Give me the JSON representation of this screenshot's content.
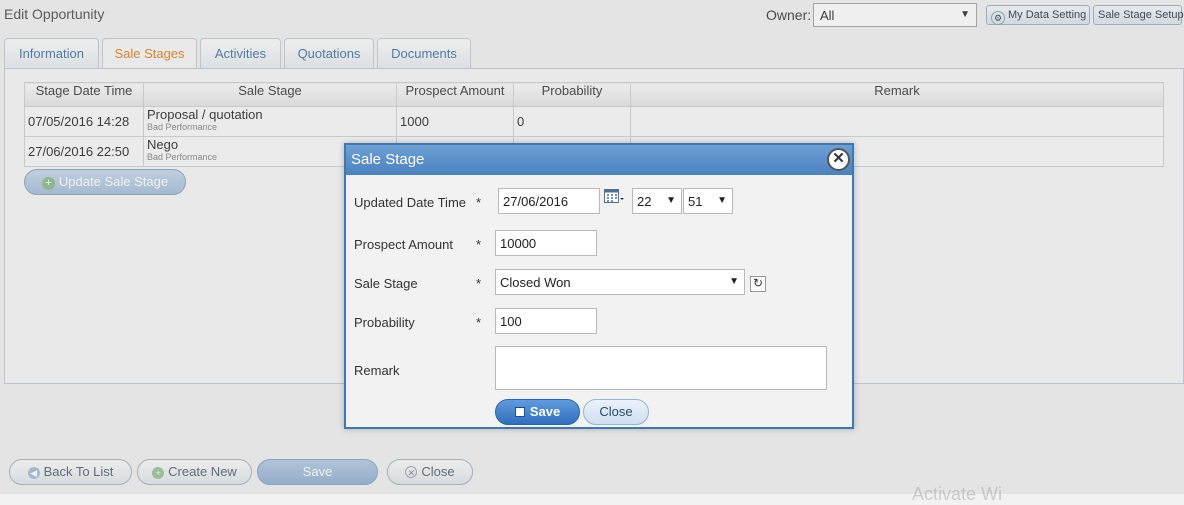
{
  "page": {
    "title": "Edit Opportunity",
    "owner_label": "Owner:",
    "owner_value": "All",
    "my_data_setting": "My Data Setting",
    "sale_stage_setup": "Sale Stage Setup"
  },
  "tabs": [
    {
      "label": "Information"
    },
    {
      "label": "Sale Stages"
    },
    {
      "label": "Activities"
    },
    {
      "label": "Quotations"
    },
    {
      "label": "Documents"
    }
  ],
  "grid": {
    "headers": [
      "Stage Date Time",
      "Sale Stage",
      "Prospect Amount",
      "Probability",
      "Remark"
    ],
    "rows": [
      {
        "date": "07/05/2016 14:28",
        "stage": "Proposal / quotation",
        "sub": "Bad Performance",
        "amount": "1000",
        "probability": "0",
        "remark": ""
      },
      {
        "date": "27/06/2016 22:50",
        "stage": "Nego",
        "sub": "Bad Performance",
        "amount": "",
        "probability": "",
        "remark": ""
      }
    ]
  },
  "update_button": "Update Sale Stage",
  "footer": {
    "back": "Back To List",
    "create": "Create New",
    "save": "Save",
    "close": "Close"
  },
  "dialog": {
    "title": "Sale Stage",
    "labels": {
      "updated": "Updated Date Time",
      "amount": "Prospect Amount",
      "stage": "Sale Stage",
      "probability": "Probability",
      "remark": "Remark"
    },
    "required": "*",
    "date_value": "27/06/2016",
    "hour_value": "22",
    "minute_value": "51",
    "amount_value": "10000",
    "stage_value": "Closed Won",
    "probability_value": "100",
    "remark_value": "",
    "save_label": "Save",
    "close_label": "Close"
  },
  "watermark": "Activate Wi",
  "icons": {
    "calendar": "calendar-icon",
    "refresh": "refresh-icon",
    "close": "close-icon",
    "save": "disk-icon"
  },
  "colors": {
    "dialog_header": "#4a82bf",
    "active_tab": "#e8822a",
    "primary_button": "#2f6fbf"
  }
}
